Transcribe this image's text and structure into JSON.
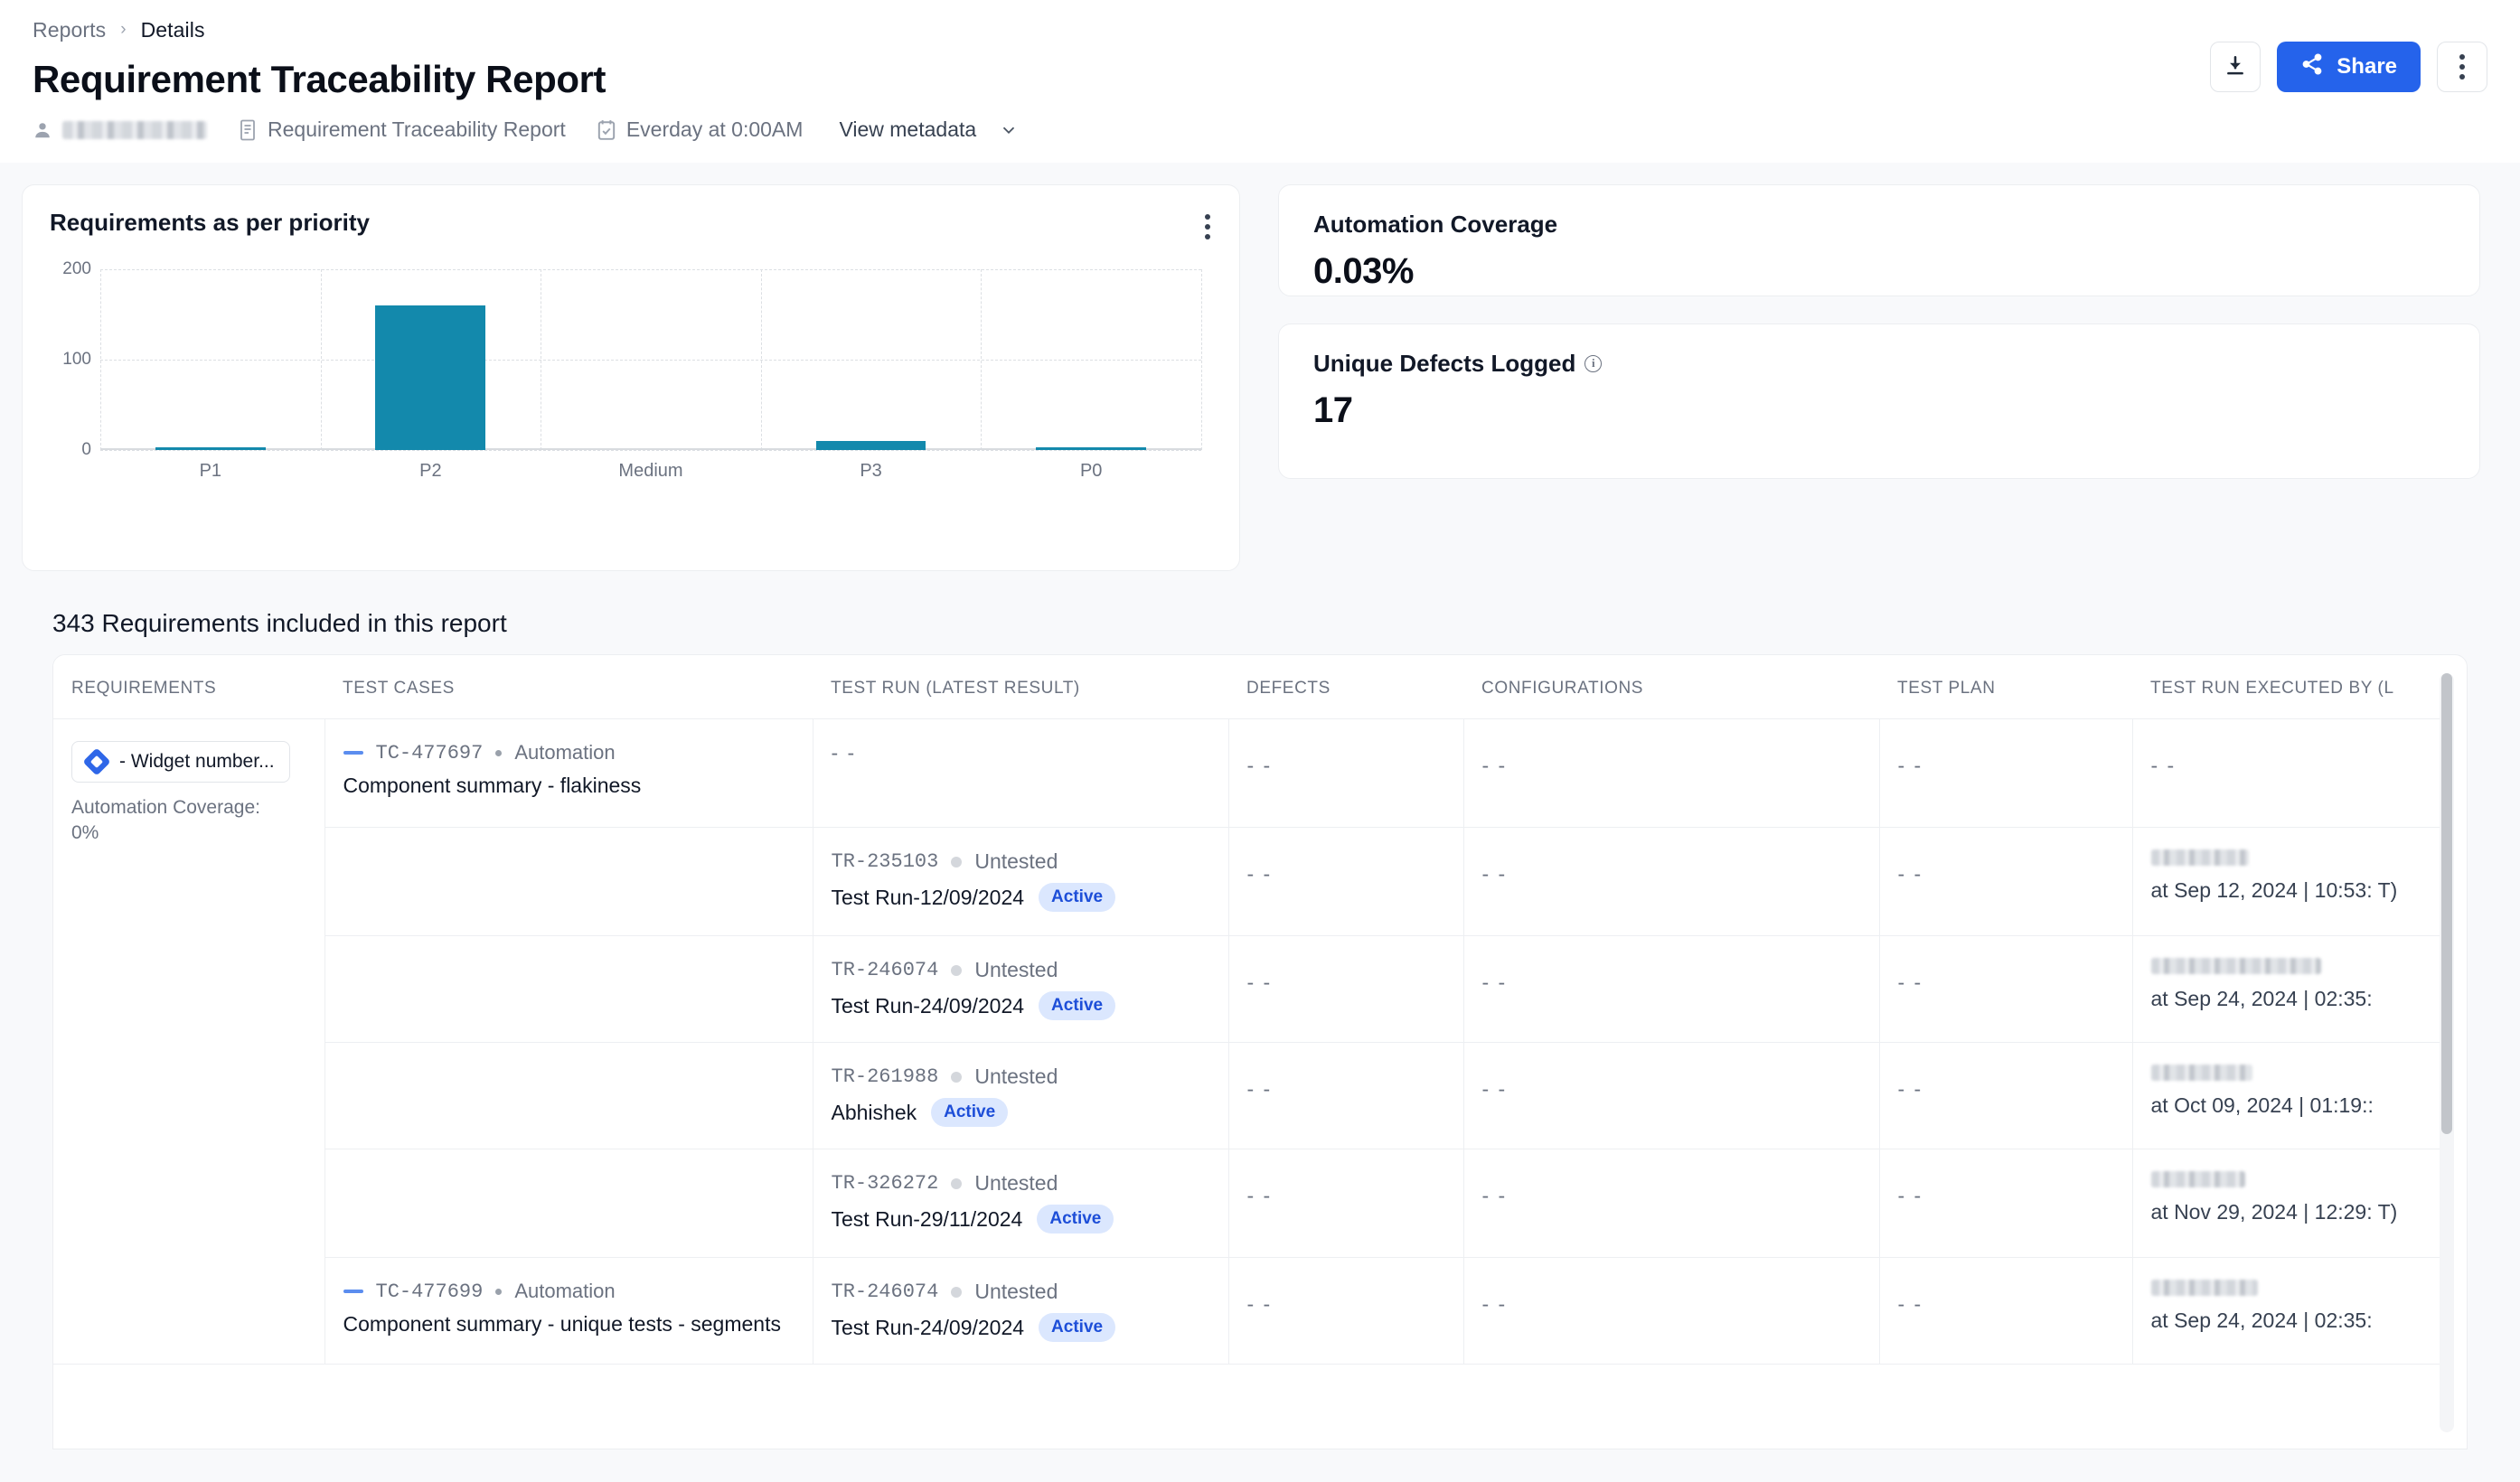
{
  "breadcrumb": {
    "parent": "Reports",
    "separator": "›",
    "current": "Details"
  },
  "header": {
    "title": "Requirement Traceability Report",
    "meta": {
      "owner_label": "",
      "report_type": "Requirement Traceability Report",
      "schedule": "Everday at 0:00AM",
      "view_metadata": "View metadata"
    },
    "actions": {
      "download_label": "download-icon",
      "share_label": "Share",
      "more_label": "more-options"
    }
  },
  "chart_card": {
    "title": "Requirements as per priority",
    "menu_label": "chart-options"
  },
  "chart_data": {
    "type": "bar",
    "title": "Requirements as per priority",
    "categories": [
      "P1",
      "P2",
      "Medium",
      "P3",
      "P0"
    ],
    "values": [
      2,
      160,
      0,
      10,
      2
    ],
    "xlabel": "",
    "ylabel": "",
    "ylim": [
      0,
      200
    ],
    "yticks": [
      0,
      100,
      200
    ],
    "grid": true,
    "legend": false,
    "bar_color": "#1389ac"
  },
  "kpis": [
    {
      "label": "Automation Coverage",
      "value": "0.03%",
      "has_info": false
    },
    {
      "label": "Unique Defects Logged",
      "value": "17",
      "has_info": true
    }
  ],
  "table": {
    "heading": "343 Requirements included in this report",
    "columns": [
      "REQUIREMENTS",
      "TEST CASES",
      "TEST RUN (LATEST RESULT)",
      "DEFECTS",
      "CONFIGURATIONS",
      "TEST PLAN",
      "TEST RUN EXECUTED BY (L"
    ],
    "empty_value": "- -",
    "requirement": {
      "badge_text": "- Widget number...",
      "coverage_text": "Automation Coverage: 0%"
    },
    "rows": [
      {
        "test_case": {
          "id": "TC-477697",
          "type": "Automation",
          "name": "Component summary - flakiness"
        },
        "test_run": null,
        "defects": "- -",
        "configurations": "- -",
        "test_plan": "- -",
        "executed_by": null
      },
      {
        "test_case": null,
        "test_run": {
          "id": "TR-235103",
          "status": "Untested",
          "name": "Test Run-12/09/2024",
          "pill": "Active"
        },
        "defects": "- -",
        "configurations": "- -",
        "test_plan": "- -",
        "executed_by": {
          "date": "at Sep 12, 2024 | 10:53: T)"
        }
      },
      {
        "test_case": null,
        "test_run": {
          "id": "TR-246074",
          "status": "Untested",
          "name": "Test Run-24/09/2024",
          "pill": "Active"
        },
        "defects": "- -",
        "configurations": "- -",
        "test_plan": "- -",
        "executed_by": {
          "date": "at Sep 24, 2024 | 02:35:"
        }
      },
      {
        "test_case": null,
        "test_run": {
          "id": "TR-261988",
          "status": "Untested",
          "name": "Abhishek",
          "pill": "Active"
        },
        "defects": "- -",
        "configurations": "- -",
        "test_plan": "- -",
        "executed_by": {
          "date": "at Oct 09, 2024 | 01:19::"
        }
      },
      {
        "test_case": null,
        "test_run": {
          "id": "TR-326272",
          "status": "Untested",
          "name": "Test Run-29/11/2024",
          "pill": "Active"
        },
        "defects": "- -",
        "configurations": "- -",
        "test_plan": "- -",
        "executed_by": {
          "date": "at Nov 29, 2024 | 12:29: T)"
        }
      },
      {
        "test_case": {
          "id": "TC-477699",
          "type": "Automation",
          "name": "Component summary - unique tests - segments"
        },
        "test_run": {
          "id": "TR-246074",
          "status": "Untested",
          "name": "Test Run-24/09/2024",
          "pill": "Active"
        },
        "defects": "- -",
        "configurations": "- -",
        "test_plan": "- -",
        "executed_by": {
          "date": "at Sep 24, 2024 | 02:35:"
        }
      }
    ]
  },
  "colors": {
    "accent": "#2563eb",
    "bar": "#1389ac",
    "pill_bg": "#dbe7fe",
    "pill_text": "#1d4ed8"
  }
}
